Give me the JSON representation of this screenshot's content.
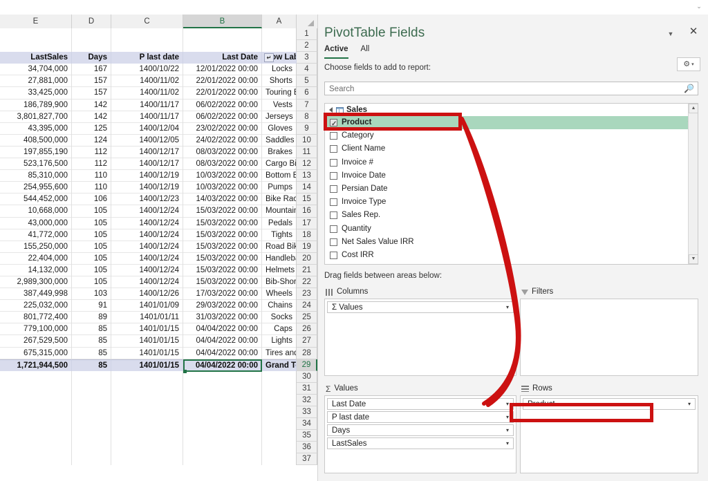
{
  "window": {
    "top_strip_chevron": "⌄"
  },
  "sheet": {
    "columns": [
      "E",
      "D",
      "C",
      "B",
      "A"
    ],
    "selected_column": "B",
    "select_all_icon": "select-all-triangle",
    "row_numbers": [
      1,
      2,
      3,
      4,
      5,
      6,
      7,
      8,
      9,
      10,
      11,
      12,
      13,
      14,
      15,
      16,
      17,
      18,
      19,
      20,
      21,
      22,
      23,
      24,
      25,
      26,
      27,
      28,
      29,
      30,
      31,
      32,
      33,
      34,
      35,
      36,
      37
    ],
    "highlighted_row_number": 29,
    "active_cell": "B29",
    "header_row_index": 3,
    "headers": {
      "LastSales": "LastSales",
      "Days": "Days",
      "P_last_date": "P last date",
      "Last_Date": "Last Date",
      "Row_Labels": "Row Labels",
      "sort_button_glyph": "↵"
    },
    "rows": [
      {
        "n": 4,
        "lastsales": "34,704,000",
        "days": "167",
        "plastdate": "1400/10/22",
        "lastdate": "12/01/2022 00:00",
        "label": "Locks"
      },
      {
        "n": 5,
        "lastsales": "27,881,000",
        "days": "157",
        "plastdate": "1400/11/02",
        "lastdate": "22/01/2022 00:00",
        "label": "Shorts"
      },
      {
        "n": 6,
        "lastsales": "33,425,000",
        "days": "157",
        "plastdate": "1400/11/02",
        "lastdate": "22/01/2022 00:00",
        "label": "Touring Bikes"
      },
      {
        "n": 7,
        "lastsales": "186,789,900",
        "days": "142",
        "plastdate": "1400/11/17",
        "lastdate": "06/02/2022 00:00",
        "label": "Vests"
      },
      {
        "n": 8,
        "lastsales": "3,801,827,700",
        "days": "142",
        "plastdate": "1400/11/17",
        "lastdate": "06/02/2022 00:00",
        "label": "Jerseys"
      },
      {
        "n": 9,
        "lastsales": "43,395,000",
        "days": "125",
        "plastdate": "1400/12/04",
        "lastdate": "23/02/2022 00:00",
        "label": "Gloves"
      },
      {
        "n": 10,
        "lastsales": "408,500,000",
        "days": "124",
        "plastdate": "1400/12/05",
        "lastdate": "24/02/2022 00:00",
        "label": "Saddles"
      },
      {
        "n": 11,
        "lastsales": "197,855,190",
        "days": "112",
        "plastdate": "1400/12/17",
        "lastdate": "08/03/2022 00:00",
        "label": "Brakes"
      },
      {
        "n": 12,
        "lastsales": "523,176,500",
        "days": "112",
        "plastdate": "1400/12/17",
        "lastdate": "08/03/2022 00:00",
        "label": "Cargo Bike"
      },
      {
        "n": 13,
        "lastsales": "85,310,000",
        "days": "110",
        "plastdate": "1400/12/19",
        "lastdate": "10/03/2022 00:00",
        "label": "Bottom Brackets"
      },
      {
        "n": 14,
        "lastsales": "254,955,600",
        "days": "110",
        "plastdate": "1400/12/19",
        "lastdate": "10/03/2022 00:00",
        "label": "Pumps"
      },
      {
        "n": 15,
        "lastsales": "544,452,000",
        "days": "106",
        "plastdate": "1400/12/23",
        "lastdate": "14/03/2022 00:00",
        "label": "Bike Racks"
      },
      {
        "n": 16,
        "lastsales": "10,668,000",
        "days": "105",
        "plastdate": "1400/12/24",
        "lastdate": "15/03/2022 00:00",
        "label": "Mountain Bikes"
      },
      {
        "n": 17,
        "lastsales": "43,000,000",
        "days": "105",
        "plastdate": "1400/12/24",
        "lastdate": "15/03/2022 00:00",
        "label": "Pedals"
      },
      {
        "n": 18,
        "lastsales": "41,772,000",
        "days": "105",
        "plastdate": "1400/12/24",
        "lastdate": "15/03/2022 00:00",
        "label": "Tights"
      },
      {
        "n": 19,
        "lastsales": "155,250,000",
        "days": "105",
        "plastdate": "1400/12/24",
        "lastdate": "15/03/2022 00:00",
        "label": "Road Bikes"
      },
      {
        "n": 20,
        "lastsales": "22,404,000",
        "days": "105",
        "plastdate": "1400/12/24",
        "lastdate": "15/03/2022 00:00",
        "label": "Handlebars"
      },
      {
        "n": 21,
        "lastsales": "14,132,000",
        "days": "105",
        "plastdate": "1400/12/24",
        "lastdate": "15/03/2022 00:00",
        "label": "Helmets"
      },
      {
        "n": 22,
        "lastsales": "2,989,300,000",
        "days": "105",
        "plastdate": "1400/12/24",
        "lastdate": "15/03/2022 00:00",
        "label": "Bib-Shorts"
      },
      {
        "n": 23,
        "lastsales": "387,449,998",
        "days": "103",
        "plastdate": "1400/12/26",
        "lastdate": "17/03/2022 00:00",
        "label": "Wheels"
      },
      {
        "n": 24,
        "lastsales": "225,032,000",
        "days": "91",
        "plastdate": "1401/01/09",
        "lastdate": "29/03/2022 00:00",
        "label": "Chains"
      },
      {
        "n": 25,
        "lastsales": "801,772,400",
        "days": "89",
        "plastdate": "1401/01/11",
        "lastdate": "31/03/2022 00:00",
        "label": "Socks"
      },
      {
        "n": 26,
        "lastsales": "779,100,000",
        "days": "85",
        "plastdate": "1401/01/15",
        "lastdate": "04/04/2022 00:00",
        "label": "Caps"
      },
      {
        "n": 27,
        "lastsales": "267,529,500",
        "days": "85",
        "plastdate": "1401/01/15",
        "lastdate": "04/04/2022 00:00",
        "label": "Lights"
      },
      {
        "n": 28,
        "lastsales": "675,315,000",
        "days": "85",
        "plastdate": "1401/01/15",
        "lastdate": "04/04/2022 00:00",
        "label": "Tires and Tubes"
      }
    ],
    "grand_total": {
      "n": 29,
      "lastsales": "1,721,944,500",
      "days": "85",
      "plastdate": "1401/01/15",
      "lastdate": "04/04/2022 00:00",
      "label": "Grand Total"
    }
  },
  "pane": {
    "title": "PivotTable Fields",
    "collapse_glyph": "▼",
    "close_glyph": "✕",
    "tabs": [
      {
        "label": "Active",
        "active": true
      },
      {
        "label": "All",
        "active": false
      }
    ],
    "choose_label": "Choose fields to add to report:",
    "tools_glyph": "⚙",
    "tools_chevron": "▾",
    "search": {
      "placeholder": "Search",
      "value": "",
      "icon": "search-icon"
    },
    "field_list": {
      "table_name": "Sales",
      "fields": [
        {
          "label": "Product",
          "checked": true
        },
        {
          "label": "Category",
          "checked": false
        },
        {
          "label": "Client Name",
          "checked": false
        },
        {
          "label": "Invoice #",
          "checked": false
        },
        {
          "label": "Invoice Date",
          "checked": false
        },
        {
          "label": "Persian Date",
          "checked": false
        },
        {
          "label": "Invoice Type",
          "checked": false
        },
        {
          "label": "Sales Rep.",
          "checked": false
        },
        {
          "label": "Quantity",
          "checked": false
        },
        {
          "label": "Net Sales Value IRR",
          "checked": false
        },
        {
          "label": "Cost IRR",
          "checked": false
        }
      ],
      "scroll_up_glyph": "▲",
      "scroll_down_glyph": "▼"
    },
    "drag_hint": "Drag fields between areas below:",
    "areas": {
      "columns": {
        "label": "Columns",
        "items": [
          {
            "label": "Σ Values"
          }
        ]
      },
      "filters": {
        "label": "Filters",
        "items": []
      },
      "values": {
        "label": "Values",
        "items": [
          {
            "label": "Last Date"
          },
          {
            "label": "P last date"
          },
          {
            "label": "Days"
          },
          {
            "label": "LastSales"
          }
        ]
      },
      "rows": {
        "label": "Rows",
        "items": [
          {
            "label": "Product"
          }
        ]
      }
    }
  },
  "annotations": {
    "accent_color": "#cc1111",
    "highlight_color": "#a9d7bd"
  }
}
